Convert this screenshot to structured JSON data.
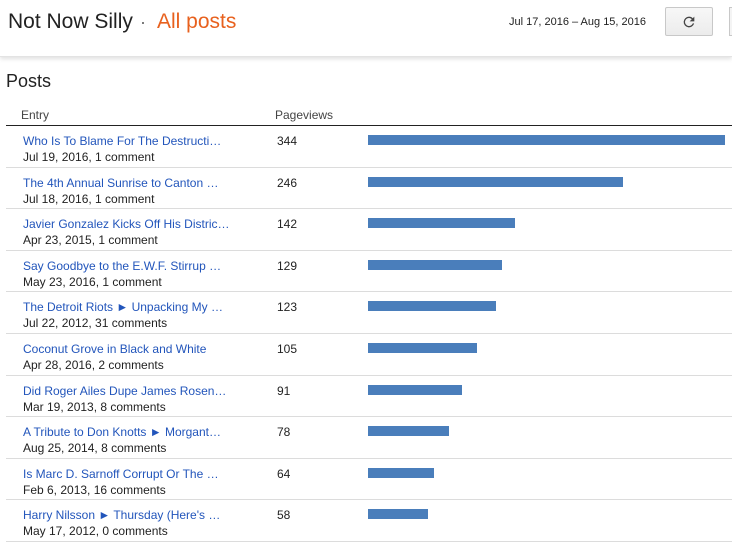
{
  "header": {
    "blog_title": "Not Now Silly",
    "separator": "·",
    "section_title": "All posts",
    "date_range": "Jul 17, 2016 – Aug 15, 2016",
    "refresh_icon": "refresh-icon"
  },
  "page": {
    "heading": "Posts"
  },
  "table": {
    "columns": [
      "Entry",
      "Pageviews"
    ],
    "max_pageviews": 344,
    "bar_color": "#4a7ebb",
    "rows": [
      {
        "title": "Who Is To Blame For The Destructi…",
        "meta": "Jul 19, 2016, 1 comment",
        "pageviews": 344
      },
      {
        "title": "The 4th Annual Sunrise to Canton …",
        "meta": "Jul 18, 2016, 1 comment",
        "pageviews": 246
      },
      {
        "title": "Javier Gonzalez Kicks Off His Distric…",
        "meta": "Apr 23, 2015, 1 comment",
        "pageviews": 142
      },
      {
        "title": "Say Goodbye to the E.W.F. Stirrup …",
        "meta": "May 23, 2016, 1 comment",
        "pageviews": 129
      },
      {
        "title": "The Detroit Riots ► Unpacking My …",
        "meta": "Jul 22, 2012, 31 comments",
        "pageviews": 123
      },
      {
        "title": "Coconut Grove in Black and White",
        "meta": "Apr 28, 2016, 2 comments",
        "pageviews": 105
      },
      {
        "title": "Did Roger Ailes Dupe James Rosen…",
        "meta": "Mar 19, 2013, 8 comments",
        "pageviews": 91
      },
      {
        "title": "A Tribute to Don Knotts ► Morgant…",
        "meta": "Aug 25, 2014, 8 comments",
        "pageviews": 78
      },
      {
        "title": "Is Marc D. Sarnoff Corrupt Or The …",
        "meta": "Feb 6, 2013, 16 comments",
        "pageviews": 64
      },
      {
        "title": "Harry Nilsson ► Thursday (Here's …",
        "meta": "May 17, 2012, 0 comments",
        "pageviews": 58
      }
    ]
  }
}
